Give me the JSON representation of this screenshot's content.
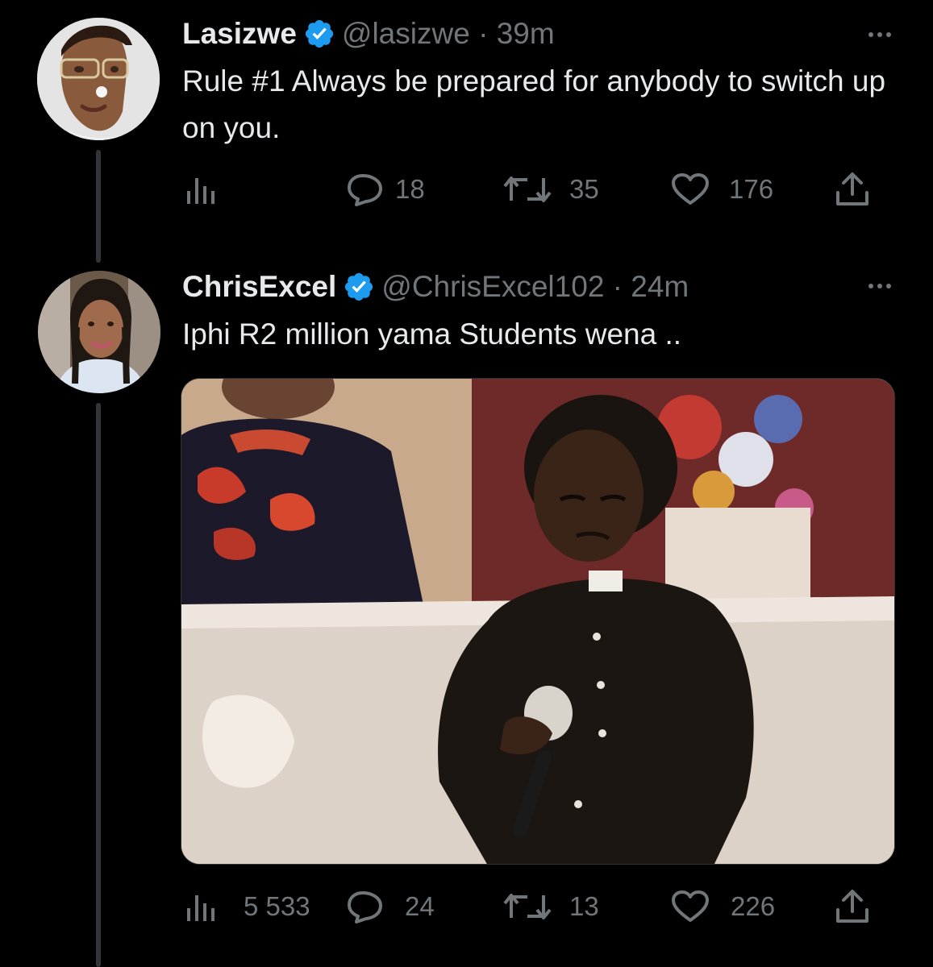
{
  "tweets": [
    {
      "display_name": "Lasizwe",
      "verified": true,
      "handle": "@lasizwe",
      "time": "39m",
      "text": "Rule #1 Always be prepared for anybody to switch up on you.",
      "avatar_icon": "user-avatar",
      "stats": {
        "views": "",
        "replies": "18",
        "retweets": "35",
        "likes": "176"
      }
    },
    {
      "display_name": "ChrisExcel",
      "verified": true,
      "handle": "@ChrisExcel102",
      "time": "24m",
      "text": "Iphi R2 million yama Students wena ..",
      "avatar_icon": "user-avatar",
      "media": {
        "type": "image",
        "icon": "boy-with-microphone-photo"
      },
      "stats": {
        "views": "5 533",
        "replies": "24",
        "retweets": "13",
        "likes": "226"
      }
    }
  ],
  "meta_separator": " · ",
  "colors": {
    "background": "#000000",
    "text": "#e7e9ea",
    "muted": "#71767b",
    "verified": "#1d9bf0"
  }
}
